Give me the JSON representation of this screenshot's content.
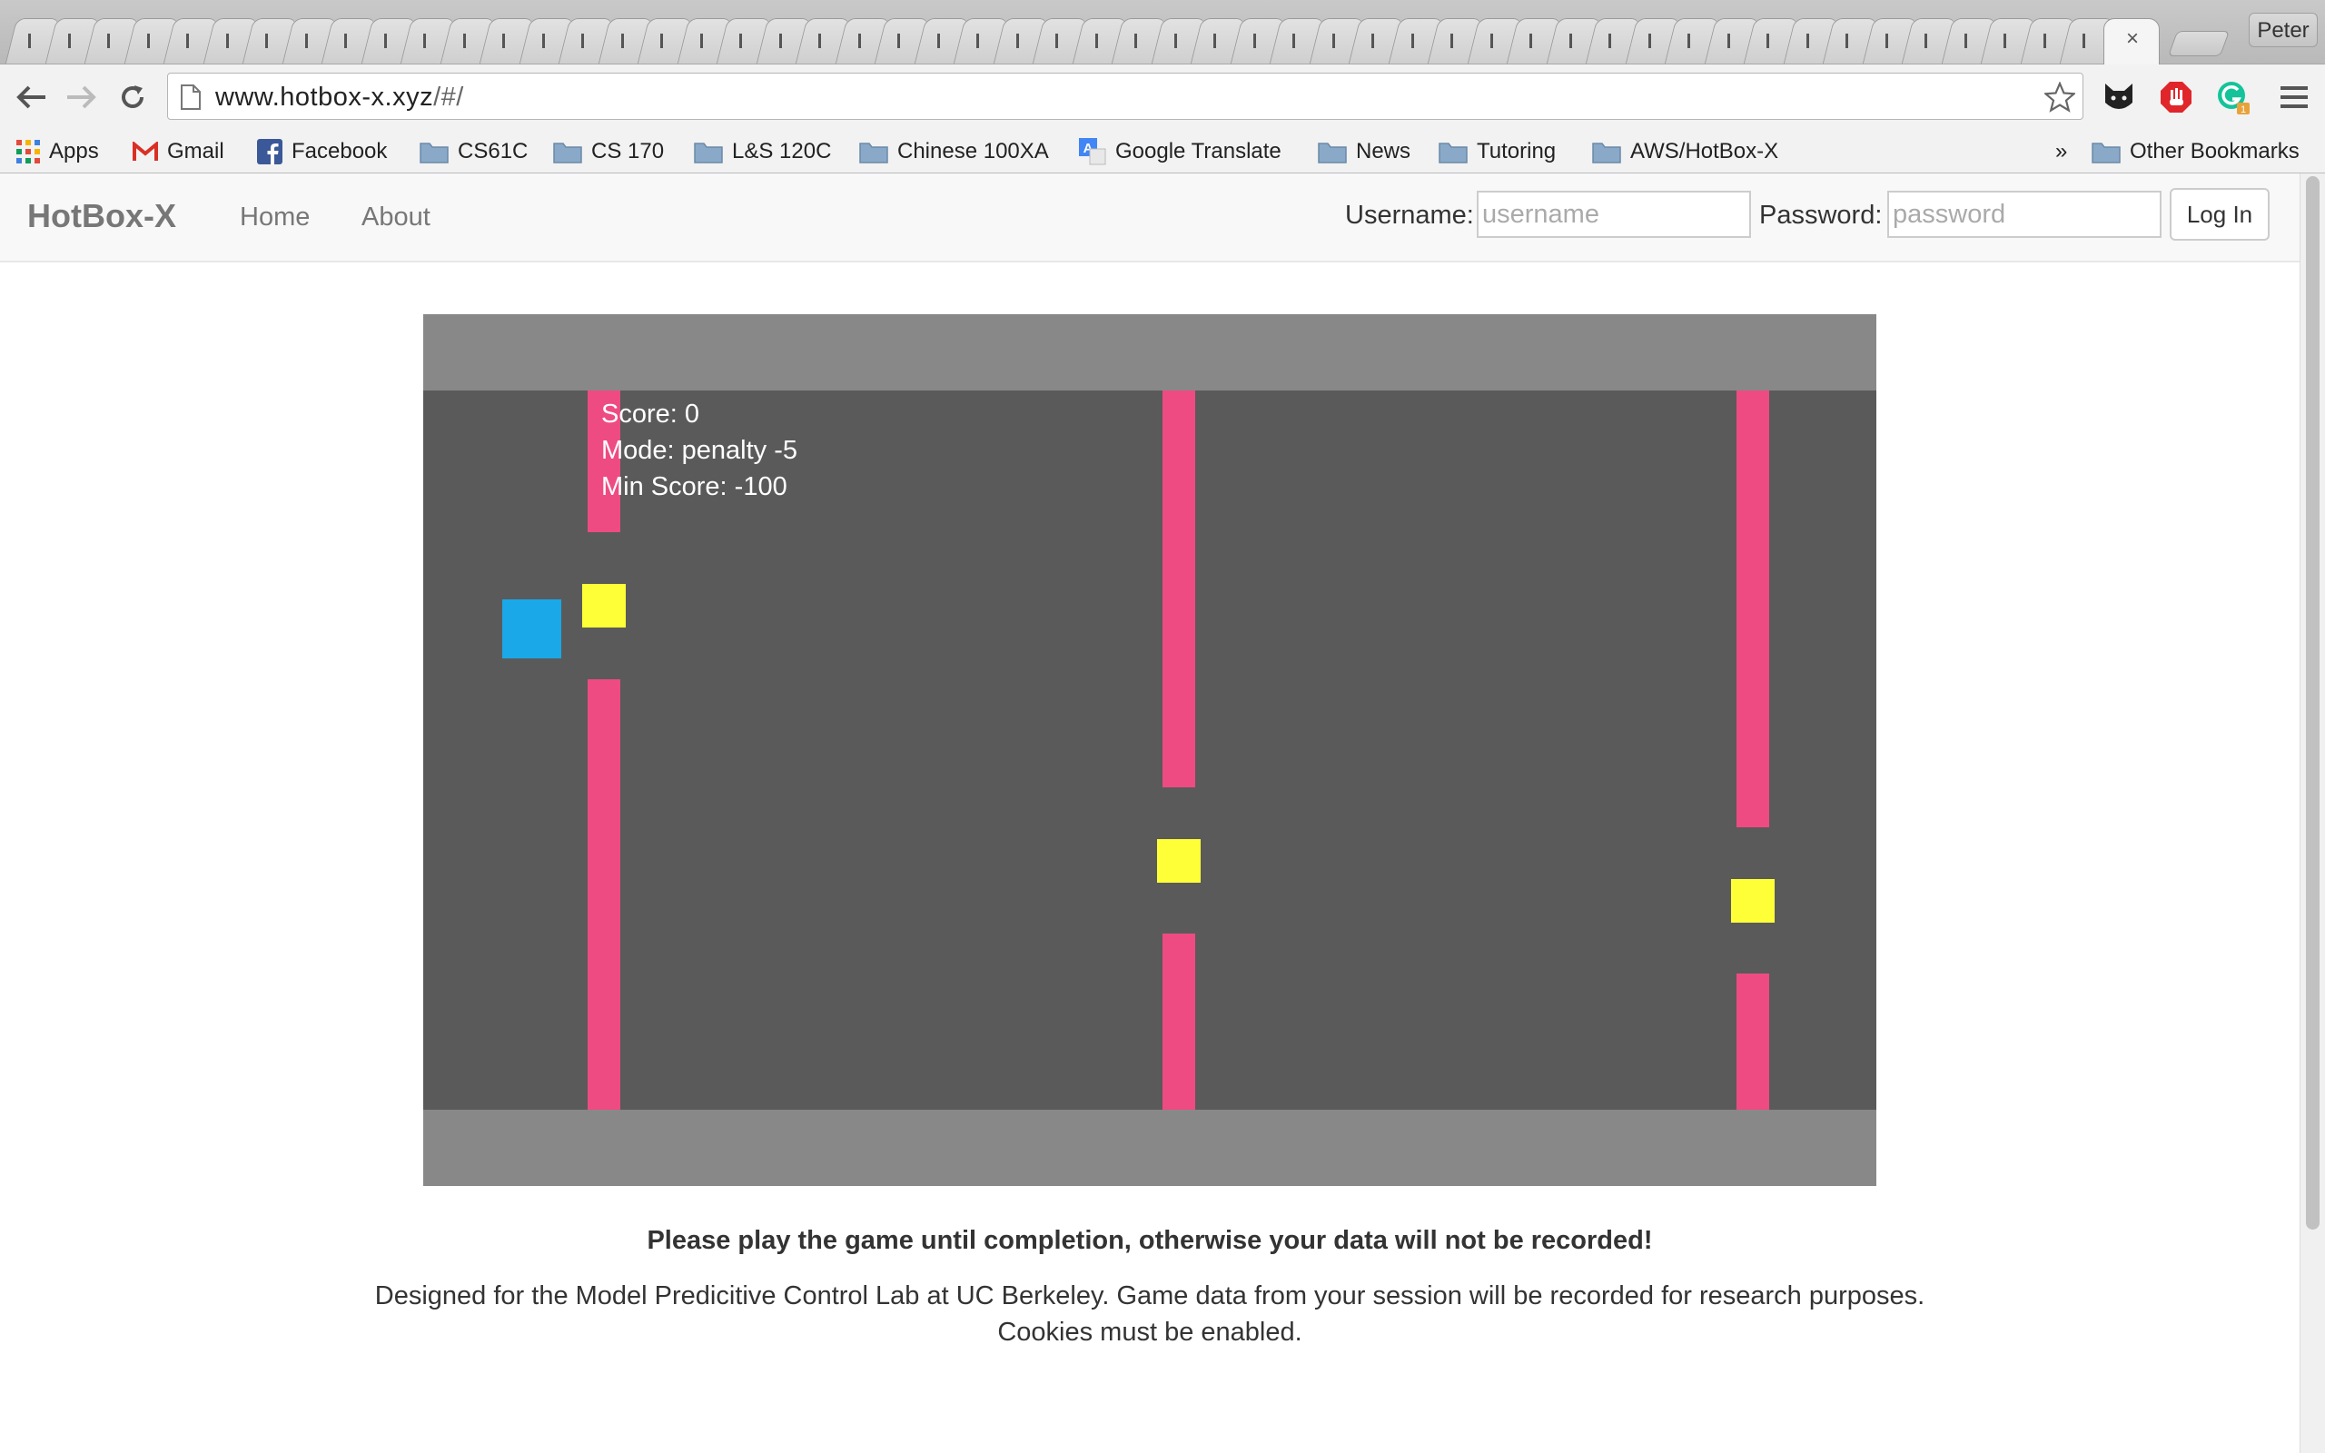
{
  "browser": {
    "url_host": "www.hotbox-x.xyz",
    "url_path": "/#/",
    "profile_name": "Peter",
    "close_glyph": "×",
    "extensions": [
      "cat-icon",
      "stop-hand-icon",
      "grammarly-icon",
      "menu-icon"
    ],
    "extension_badge": "1"
  },
  "bookmarks": {
    "items": [
      {
        "label": "Apps",
        "icon": "apps-grid-icon"
      },
      {
        "label": "Gmail",
        "icon": "gmail-icon"
      },
      {
        "label": "Facebook",
        "icon": "facebook-icon"
      },
      {
        "label": "CS61C",
        "icon": "folder-icon"
      },
      {
        "label": "CS 170",
        "icon": "folder-icon"
      },
      {
        "label": "L&S 120C",
        "icon": "folder-icon"
      },
      {
        "label": "Chinese 100XA",
        "icon": "folder-icon"
      },
      {
        "label": "Google Translate",
        "icon": "translate-icon"
      },
      {
        "label": "News",
        "icon": "folder-icon"
      },
      {
        "label": "Tutoring",
        "icon": "folder-icon"
      },
      {
        "label": "AWS/HotBox-X",
        "icon": "folder-icon"
      }
    ],
    "overflow": "»",
    "other": "Other Bookmarks"
  },
  "site": {
    "brand": "HotBox-X",
    "nav": [
      "Home",
      "About"
    ],
    "username_label": "Username:",
    "username_placeholder": "username",
    "password_label": "Password:",
    "password_placeholder": "password",
    "login_button": "Log In"
  },
  "game": {
    "score": "Score: 0",
    "mode": "Mode: penalty -5",
    "min_score": "Min Score: -100",
    "colors": {
      "background": "#5a5a5a",
      "bands": "#888888",
      "pipes": "#ee4b83",
      "coins": "#ffff38",
      "player": "#1aa8e8"
    }
  },
  "notice": "Please play the game until completion, otherwise your data will not be recorded!",
  "footer": {
    "line1": "Designed for the Model Predicitive Control Lab at UC Berkeley. Game data from your session will be recorded for research purposes.",
    "line2": "Cookies must be enabled."
  }
}
